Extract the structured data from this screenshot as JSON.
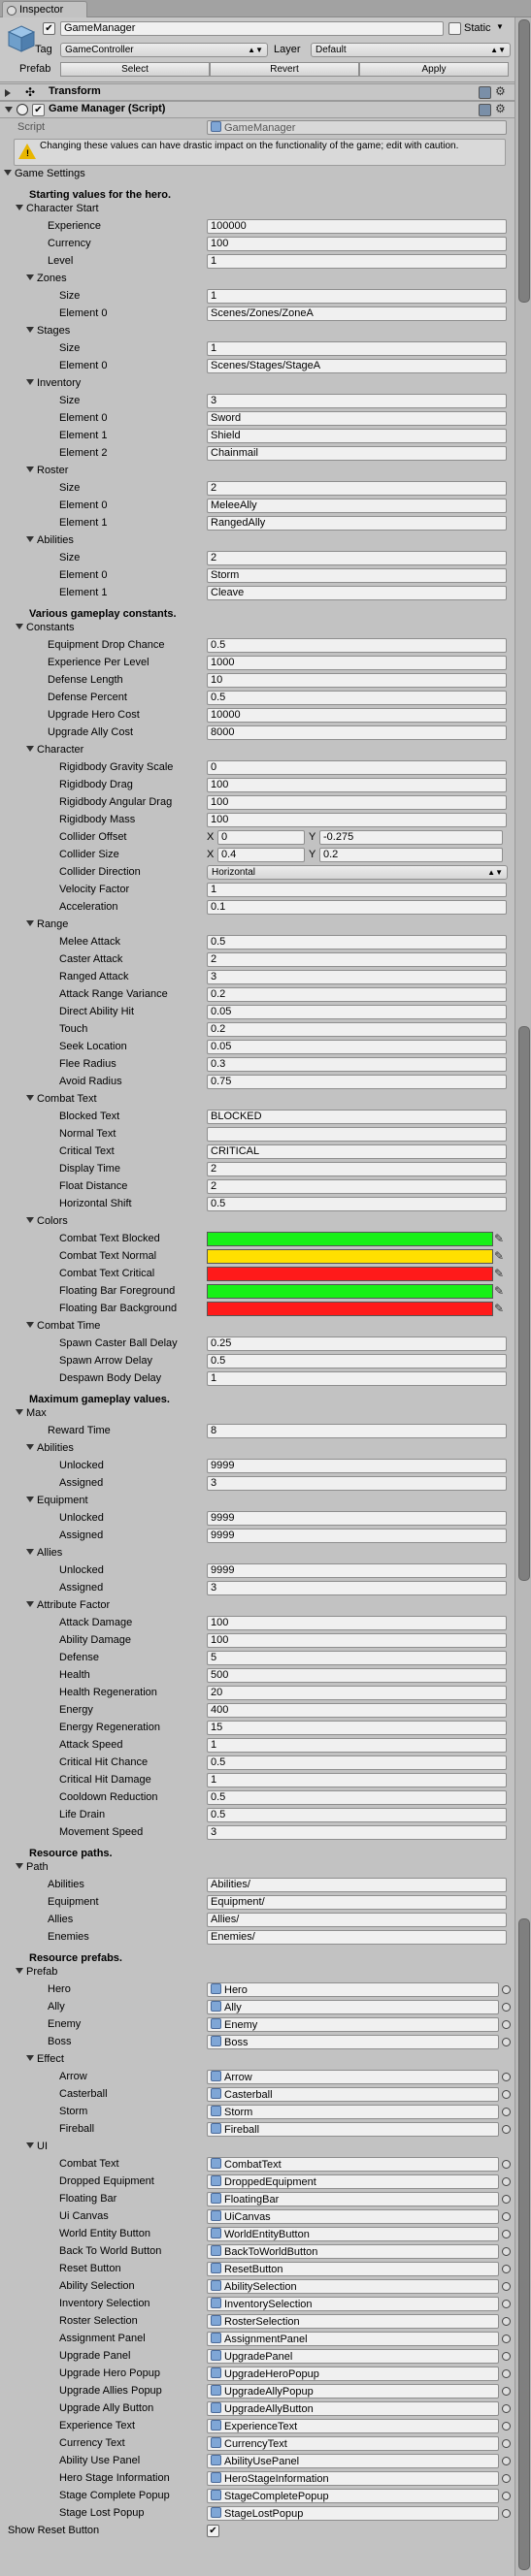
{
  "window": {
    "tab_label": "Inspector"
  },
  "header": {
    "object_name": "GameManager",
    "static_label": "Static",
    "tag_label": "Tag",
    "tag_value": "GameController",
    "layer_label": "Layer",
    "layer_value": "Default",
    "prefab_label": "Prefab",
    "select_label": "Select",
    "revert_label": "Revert",
    "apply_label": "Apply"
  },
  "components": {
    "transform": "Transform",
    "game_manager": "Game Manager (Script)",
    "script_label": "Script",
    "script_value": "GameManager",
    "warning": "Changing these values can have drastic impact on the functionality of the game; edit with caution."
  },
  "rows": [
    {
      "t": "fold",
      "d": 0,
      "label": "Game Settings"
    },
    {
      "t": "header",
      "d": 1,
      "label": "Starting values for the hero."
    },
    {
      "t": "fold",
      "d": 1,
      "label": "Character Start"
    },
    {
      "t": "field",
      "d": 2,
      "label": "Experience",
      "value": "100000"
    },
    {
      "t": "field",
      "d": 2,
      "label": "Currency",
      "value": "100"
    },
    {
      "t": "field",
      "d": 2,
      "label": "Level",
      "value": "1"
    },
    {
      "t": "fold",
      "d": 2,
      "label": "Zones"
    },
    {
      "t": "field",
      "d": 3,
      "label": "Size",
      "value": "1"
    },
    {
      "t": "field",
      "d": 3,
      "label": "Element 0",
      "value": "Scenes/Zones/ZoneA"
    },
    {
      "t": "fold",
      "d": 2,
      "label": "Stages"
    },
    {
      "t": "field",
      "d": 3,
      "label": "Size",
      "value": "1"
    },
    {
      "t": "field",
      "d": 3,
      "label": "Element 0",
      "value": "Scenes/Stages/StageA"
    },
    {
      "t": "fold",
      "d": 2,
      "label": "Inventory"
    },
    {
      "t": "field",
      "d": 3,
      "label": "Size",
      "value": "3"
    },
    {
      "t": "field",
      "d": 3,
      "label": "Element 0",
      "value": "Sword"
    },
    {
      "t": "field",
      "d": 3,
      "label": "Element 1",
      "value": "Shield"
    },
    {
      "t": "field",
      "d": 3,
      "label": "Element 2",
      "value": "Chainmail"
    },
    {
      "t": "fold",
      "d": 2,
      "label": "Roster"
    },
    {
      "t": "field",
      "d": 3,
      "label": "Size",
      "value": "2"
    },
    {
      "t": "field",
      "d": 3,
      "label": "Element 0",
      "value": "MeleeAlly"
    },
    {
      "t": "field",
      "d": 3,
      "label": "Element 1",
      "value": "RangedAlly"
    },
    {
      "t": "fold",
      "d": 2,
      "label": "Abilities"
    },
    {
      "t": "field",
      "d": 3,
      "label": "Size",
      "value": "2"
    },
    {
      "t": "field",
      "d": 3,
      "label": "Element 0",
      "value": "Storm"
    },
    {
      "t": "field",
      "d": 3,
      "label": "Element 1",
      "value": "Cleave"
    },
    {
      "t": "header",
      "d": 1,
      "label": "Various gameplay constants."
    },
    {
      "t": "fold",
      "d": 1,
      "label": "Constants"
    },
    {
      "t": "field",
      "d": 2,
      "label": "Equipment Drop Chance",
      "value": "0.5"
    },
    {
      "t": "field",
      "d": 2,
      "label": "Experience Per Level",
      "value": "1000"
    },
    {
      "t": "field",
      "d": 2,
      "label": "Defense Length",
      "value": "10"
    },
    {
      "t": "field",
      "d": 2,
      "label": "Defense Percent",
      "value": "0.5"
    },
    {
      "t": "field",
      "d": 2,
      "label": "Upgrade Hero Cost",
      "value": "10000"
    },
    {
      "t": "field",
      "d": 2,
      "label": "Upgrade Ally Cost",
      "value": "8000"
    },
    {
      "t": "fold",
      "d": 2,
      "label": "Character"
    },
    {
      "t": "field",
      "d": 3,
      "label": "Rigidbody Gravity Scale",
      "value": "0"
    },
    {
      "t": "field",
      "d": 3,
      "label": "Rigidbody Drag",
      "value": "100"
    },
    {
      "t": "field",
      "d": 3,
      "label": "Rigidbody Angular Drag",
      "value": "100"
    },
    {
      "t": "field",
      "d": 3,
      "label": "Rigidbody Mass",
      "value": "100"
    },
    {
      "t": "vec2",
      "d": 3,
      "label": "Collider Offset",
      "x": "0",
      "y": "-0.275"
    },
    {
      "t": "vec2",
      "d": 3,
      "label": "Collider Size",
      "x": "0.4",
      "y": "0.2"
    },
    {
      "t": "dropdown",
      "d": 3,
      "label": "Collider Direction",
      "value": "Horizontal"
    },
    {
      "t": "field",
      "d": 3,
      "label": "Velocity Factor",
      "value": "1"
    },
    {
      "t": "field",
      "d": 3,
      "label": "Acceleration",
      "value": "0.1"
    },
    {
      "t": "fold",
      "d": 2,
      "label": "Range"
    },
    {
      "t": "field",
      "d": 3,
      "label": "Melee Attack",
      "value": "0.5"
    },
    {
      "t": "field",
      "d": 3,
      "label": "Caster Attack",
      "value": "2"
    },
    {
      "t": "field",
      "d": 3,
      "label": "Ranged Attack",
      "value": "3"
    },
    {
      "t": "field",
      "d": 3,
      "label": "Attack Range Variance",
      "value": "0.2"
    },
    {
      "t": "field",
      "d": 3,
      "label": "Direct Ability Hit",
      "value": "0.05"
    },
    {
      "t": "field",
      "d": 3,
      "label": "Touch",
      "value": "0.2"
    },
    {
      "t": "field",
      "d": 3,
      "label": "Seek Location",
      "value": "0.05"
    },
    {
      "t": "field",
      "d": 3,
      "label": "Flee Radius",
      "value": "0.3"
    },
    {
      "t": "field",
      "d": 3,
      "label": "Avoid Radius",
      "value": "0.75"
    },
    {
      "t": "fold",
      "d": 2,
      "label": "Combat Text"
    },
    {
      "t": "field",
      "d": 3,
      "label": "Blocked Text",
      "value": "BLOCKED"
    },
    {
      "t": "field",
      "d": 3,
      "label": "Normal Text",
      "value": ""
    },
    {
      "t": "field",
      "d": 3,
      "label": "Critical Text",
      "value": "CRITICAL"
    },
    {
      "t": "field",
      "d": 3,
      "label": "Display Time",
      "value": "2"
    },
    {
      "t": "field",
      "d": 3,
      "label": "Float Distance",
      "value": "2"
    },
    {
      "t": "field",
      "d": 3,
      "label": "Horizontal Shift",
      "value": "0.5"
    },
    {
      "t": "fold",
      "d": 2,
      "label": "Colors"
    },
    {
      "t": "color",
      "d": 3,
      "label": "Combat Text Blocked",
      "color": "#18f018"
    },
    {
      "t": "color",
      "d": 3,
      "label": "Combat Text Normal",
      "color": "#ffe000"
    },
    {
      "t": "color",
      "d": 3,
      "label": "Combat Text Critical",
      "color": "#ff1a1a"
    },
    {
      "t": "color",
      "d": 3,
      "label": "Floating Bar Foreground",
      "color": "#18f018"
    },
    {
      "t": "color",
      "d": 3,
      "label": "Floating Bar Background",
      "color": "#ff1a1a"
    },
    {
      "t": "fold",
      "d": 2,
      "label": "Combat Time"
    },
    {
      "t": "field",
      "d": 3,
      "label": "Spawn Caster Ball Delay",
      "value": "0.25"
    },
    {
      "t": "field",
      "d": 3,
      "label": "Spawn Arrow Delay",
      "value": "0.5"
    },
    {
      "t": "field",
      "d": 3,
      "label": "Despawn Body Delay",
      "value": "1"
    },
    {
      "t": "header",
      "d": 1,
      "label": "Maximum gameplay values."
    },
    {
      "t": "fold",
      "d": 1,
      "label": "Max"
    },
    {
      "t": "field",
      "d": 2,
      "label": "Reward Time",
      "value": "8"
    },
    {
      "t": "fold",
      "d": 2,
      "label": "Abilities"
    },
    {
      "t": "field",
      "d": 3,
      "label": "Unlocked",
      "value": "9999"
    },
    {
      "t": "field",
      "d": 3,
      "label": "Assigned",
      "value": "3"
    },
    {
      "t": "fold",
      "d": 2,
      "label": "Equipment"
    },
    {
      "t": "field",
      "d": 3,
      "label": "Unlocked",
      "value": "9999"
    },
    {
      "t": "field",
      "d": 3,
      "label": "Assigned",
      "value": "9999"
    },
    {
      "t": "fold",
      "d": 2,
      "label": "Allies"
    },
    {
      "t": "field",
      "d": 3,
      "label": "Unlocked",
      "value": "9999"
    },
    {
      "t": "field",
      "d": 3,
      "label": "Assigned",
      "value": "3"
    },
    {
      "t": "fold",
      "d": 2,
      "label": "Attribute Factor"
    },
    {
      "t": "field",
      "d": 3,
      "label": "Attack Damage",
      "value": "100"
    },
    {
      "t": "field",
      "d": 3,
      "label": "Ability Damage",
      "value": "100"
    },
    {
      "t": "field",
      "d": 3,
      "label": "Defense",
      "value": "5"
    },
    {
      "t": "field",
      "d": 3,
      "label": "Health",
      "value": "500"
    },
    {
      "t": "field",
      "d": 3,
      "label": "Health Regeneration",
      "value": "20"
    },
    {
      "t": "field",
      "d": 3,
      "label": "Energy",
      "value": "400"
    },
    {
      "t": "field",
      "d": 3,
      "label": "Energy Regeneration",
      "value": "15"
    },
    {
      "t": "field",
      "d": 3,
      "label": "Attack Speed",
      "value": "1"
    },
    {
      "t": "field",
      "d": 3,
      "label": "Critical Hit Chance",
      "value": "0.5"
    },
    {
      "t": "field",
      "d": 3,
      "label": "Critical Hit Damage",
      "value": "1"
    },
    {
      "t": "field",
      "d": 3,
      "label": "Cooldown Reduction",
      "value": "0.5"
    },
    {
      "t": "field",
      "d": 3,
      "label": "Life Drain",
      "value": "0.5"
    },
    {
      "t": "field",
      "d": 3,
      "label": "Movement Speed",
      "value": "3"
    },
    {
      "t": "header",
      "d": 1,
      "label": "Resource paths."
    },
    {
      "t": "fold",
      "d": 1,
      "label": "Path"
    },
    {
      "t": "field",
      "d": 2,
      "label": "Abilities",
      "value": "Abilities/"
    },
    {
      "t": "field",
      "d": 2,
      "label": "Equipment",
      "value": "Equipment/"
    },
    {
      "t": "field",
      "d": 2,
      "label": "Allies",
      "value": "Allies/"
    },
    {
      "t": "field",
      "d": 2,
      "label": "Enemies",
      "value": "Enemies/"
    },
    {
      "t": "header",
      "d": 1,
      "label": "Resource prefabs."
    },
    {
      "t": "fold",
      "d": 1,
      "label": "Prefab"
    },
    {
      "t": "obj",
      "d": 2,
      "label": "Hero",
      "value": "Hero"
    },
    {
      "t": "obj",
      "d": 2,
      "label": "Ally",
      "value": "Ally"
    },
    {
      "t": "obj",
      "d": 2,
      "label": "Enemy",
      "value": "Enemy"
    },
    {
      "t": "obj",
      "d": 2,
      "label": "Boss",
      "value": "Boss"
    },
    {
      "t": "fold",
      "d": 2,
      "label": "Effect"
    },
    {
      "t": "obj",
      "d": 3,
      "label": "Arrow",
      "value": "Arrow"
    },
    {
      "t": "obj",
      "d": 3,
      "label": "Casterball",
      "value": "Casterball"
    },
    {
      "t": "obj",
      "d": 3,
      "label": "Storm",
      "value": "Storm"
    },
    {
      "t": "obj",
      "d": 3,
      "label": "Fireball",
      "value": "Fireball"
    },
    {
      "t": "fold",
      "d": 2,
      "label": "UI"
    },
    {
      "t": "obj",
      "d": 3,
      "label": "Combat Text",
      "value": "CombatText"
    },
    {
      "t": "obj",
      "d": 3,
      "label": "Dropped Equipment",
      "value": "DroppedEquipment"
    },
    {
      "t": "obj",
      "d": 3,
      "label": "Floating Bar",
      "value": "FloatingBar"
    },
    {
      "t": "obj",
      "d": 3,
      "label": "Ui Canvas",
      "value": "UiCanvas"
    },
    {
      "t": "obj",
      "d": 3,
      "label": "World Entity Button",
      "value": "WorldEntityButton"
    },
    {
      "t": "obj",
      "d": 3,
      "label": "Back To World Button",
      "value": "BackToWorldButton"
    },
    {
      "t": "obj",
      "d": 3,
      "label": "Reset Button",
      "value": "ResetButton"
    },
    {
      "t": "obj",
      "d": 3,
      "label": "Ability Selection",
      "value": "AbilitySelection"
    },
    {
      "t": "obj",
      "d": 3,
      "label": "Inventory Selection",
      "value": "InventorySelection"
    },
    {
      "t": "obj",
      "d": 3,
      "label": "Roster Selection",
      "value": "RosterSelection"
    },
    {
      "t": "obj",
      "d": 3,
      "label": "Assignment Panel",
      "value": "AssignmentPanel"
    },
    {
      "t": "obj",
      "d": 3,
      "label": "Upgrade Panel",
      "value": "UpgradePanel"
    },
    {
      "t": "obj",
      "d": 3,
      "label": "Upgrade Hero Popup",
      "value": "UpgradeHeroPopup"
    },
    {
      "t": "obj",
      "d": 3,
      "label": "Upgrade Allies Popup",
      "value": "UpgradeAllyPopup"
    },
    {
      "t": "obj",
      "d": 3,
      "label": "Upgrade Ally Button",
      "value": "UpgradeAllyButton"
    },
    {
      "t": "obj",
      "d": 3,
      "label": "Experience Text",
      "value": "ExperienceText"
    },
    {
      "t": "obj",
      "d": 3,
      "label": "Currency Text",
      "value": "CurrencyText"
    },
    {
      "t": "obj",
      "d": 3,
      "label": "Ability Use Panel",
      "value": "AbilityUsePanel"
    },
    {
      "t": "obj",
      "d": 3,
      "label": "Hero Stage Information",
      "value": "HeroStageInformation"
    },
    {
      "t": "obj",
      "d": 3,
      "label": "Stage Complete Popup",
      "value": "StageCompletePopup"
    },
    {
      "t": "obj",
      "d": 3,
      "label": "Stage Lost Popup",
      "value": "StageLostPopup"
    },
    {
      "t": "check",
      "d": 1,
      "label": "Show Reset Button",
      "checked": true
    }
  ]
}
